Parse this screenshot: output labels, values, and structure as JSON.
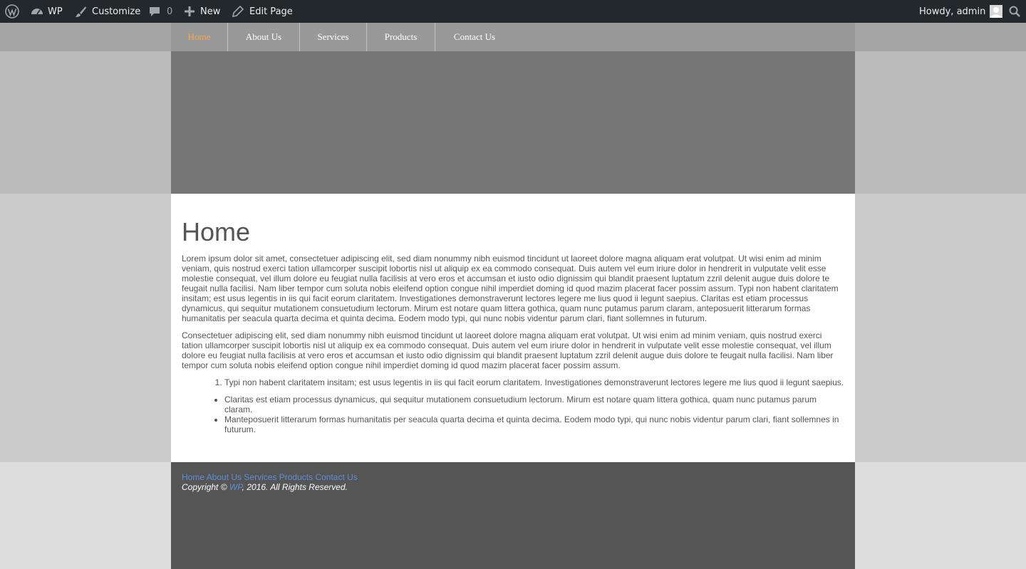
{
  "adminbar": {
    "site_name": "WP",
    "customize_label": "Customize",
    "comments_count": "0",
    "new_label": "New",
    "edit_label": "Edit Page",
    "howdy": "Howdy, admin"
  },
  "nav": {
    "items": [
      {
        "label": "Home",
        "active": true
      },
      {
        "label": "About Us"
      },
      {
        "label": "Services"
      },
      {
        "label": "Products"
      },
      {
        "label": "Contact Us"
      }
    ]
  },
  "content": {
    "title": "Home",
    "p1": "Lorem ipsum dolor sit amet, consectetuer adipiscing elit, sed diam nonummy nibh euismod tincidunt ut laoreet dolore magna aliquam erat volutpat. Ut wisi enim ad minim veniam, quis nostrud exerci tation ullamcorper suscipit lobortis nisl ut aliquip ex ea commodo consequat. Duis autem vel eum iriure dolor in hendrerit in vulputate velit esse molestie consequat, vel illum dolore eu feugiat nulla facilisis at vero eros et accumsan et iusto odio dignissim qui blandit praesent luptatum zzril delenit augue duis dolore te feugait nulla facilisi. Nam liber tempor cum soluta nobis eleifend option congue nihil imperdiet doming id quod mazim placerat facer possim assum. Typi non habent claritatem insitam; est usus legentis in iis qui facit eorum claritatem. Investigationes demonstraverunt lectores legere me lius quod ii legunt saepius. Claritas est etiam processus dynamicus, qui sequitur mutationem consuetudium lectorum. Mirum est notare quam littera gothica, quam nunc putamus parum claram, anteposuerit litterarum formas humanitatis per seacula quarta decima et quinta decima. Eodem modo typi, qui nunc nobis videntur parum clari, fiant sollemnes in futurum.",
    "p2": "Consectetuer adipiscing elit, sed diam nonummy nibh euismod tincidunt ut laoreet dolore magna aliquam erat volutpat. Ut wisi enim ad minim veniam, quis nostrud exerci tation ullamcorper suscipit lobortis nisl ut aliquip ex ea commodo consequat. Duis autem vel eum iriure dolor in hendrerit in vulputate velit esse molestie consequat, vel illum dolore eu feugiat nulla facilisis at vero eros et accumsan et iusto odio dignissim qui blandit praesent luptatum zzril delenit augue duis dolore te feugait nulla facilisi. Nam liber tempor cum soluta nobis eleifend option congue nihil imperdiet doming id quod mazim placerat facer possim assum.",
    "ordered": [
      "Typi non habent claritatem insitam; est usus legentis in iis qui facit eorum claritatem. Investigationes demonstraverunt lectores legere me lius quod ii legunt saepius."
    ],
    "bullets": [
      "Claritas est etiam processus dynamicus, qui sequitur mutationem consuetudium lectorum. Mirum est notare quam littera gothica, quam nunc putamus parum claram.",
      "Manteposuerit litterarum formas humanitatis per seacula quarta decima et quinta decima. Eodem modo typi, qui nunc nobis videntur parum clari, fiant sollemnes in futurum."
    ]
  },
  "footer": {
    "links": [
      "Home",
      "About Us",
      "Services",
      "Products",
      "Contact Us"
    ],
    "copy_prefix": "Copyright © ",
    "copy_link": "WP",
    "copy_suffix": ", 2016. All Rights Reserved."
  },
  "colors": {
    "adminbar_bg": "#23282d",
    "nav_bg": "#999999",
    "nav_active": "#f7a54a",
    "footer_link": "#5b8ed6"
  }
}
